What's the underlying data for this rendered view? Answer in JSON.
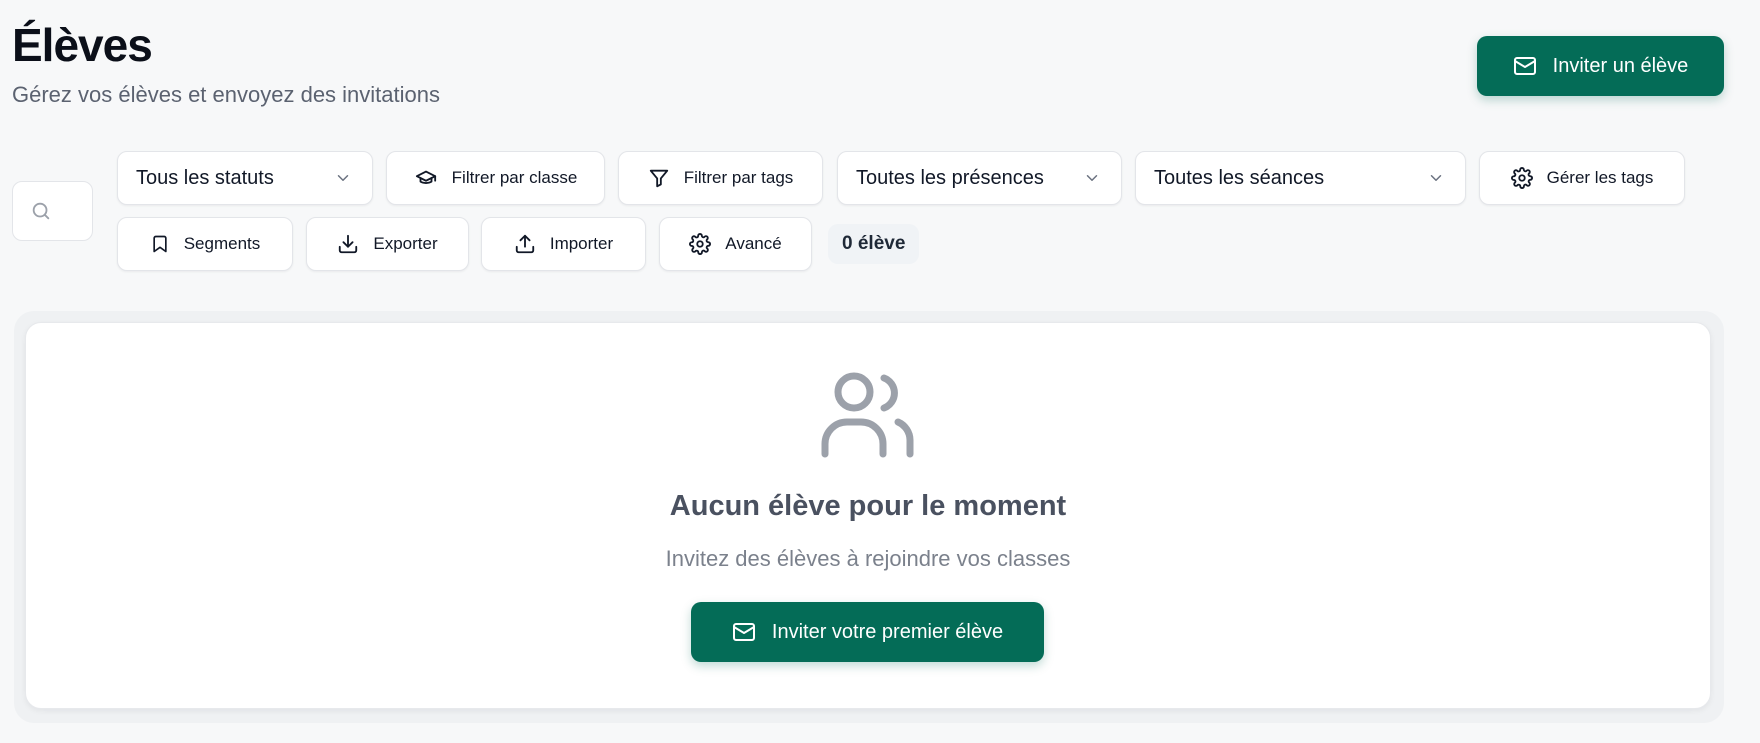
{
  "header": {
    "title": "Élèves",
    "subtitle": "Gérez vos élèves et envoyez des invitations",
    "invite_label": "Inviter un élève"
  },
  "toolbar": {
    "search_placeholder": "",
    "status_filter": "Tous les statuts",
    "class_filter": "Filtrer par classe",
    "tags_filter": "Filtrer par tags",
    "presence_filter": "Toutes les présences",
    "session_filter": "Toutes les séances",
    "manage_tags": "Gérer les tags",
    "segments": "Segments",
    "export": "Exporter",
    "import": "Importer",
    "advanced": "Avancé",
    "count": "0 élève"
  },
  "empty_state": {
    "title": "Aucun élève pour le moment",
    "text": "Invitez des élèves à rejoindre vos classes",
    "invite_label": "Inviter votre premier élève"
  },
  "colors": {
    "primary": "#046c57",
    "background": "#f7f8f9",
    "muted_icon": "#9ca1aa"
  },
  "icons": {
    "invite": "mail-icon",
    "search": "search-icon",
    "select": "chevron-down-icon",
    "class": "graduation-cap-icon",
    "tags": "funnel-icon",
    "manage_tags": "gear-icon",
    "segments": "bookmark-icon",
    "export": "download-icon",
    "import": "upload-icon",
    "advanced": "gear-icon",
    "empty": "users-icon"
  }
}
